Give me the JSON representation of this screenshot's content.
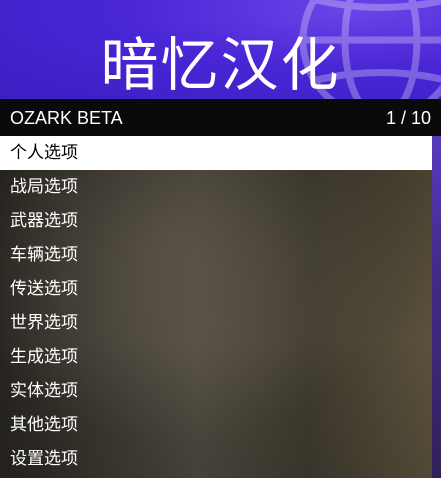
{
  "banner": {
    "title": "暗忆汉化",
    "icon": "globe-icon",
    "color": "#4a26d6"
  },
  "subheader": {
    "menu_name": "OZARK BETA",
    "position": "1 / 10"
  },
  "options": [
    {
      "label": "个人选项"
    },
    {
      "label": "战局选项"
    },
    {
      "label": "武器选项"
    },
    {
      "label": "车辆选项"
    },
    {
      "label": "传送选项"
    },
    {
      "label": "世界选项"
    },
    {
      "label": "生成选项"
    },
    {
      "label": "实体选项"
    },
    {
      "label": "其他选项"
    },
    {
      "label": "设置选项"
    }
  ],
  "selected_index": 0
}
